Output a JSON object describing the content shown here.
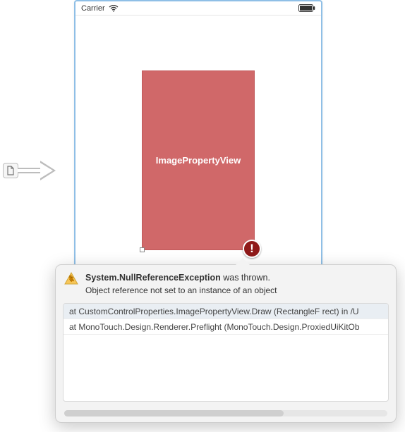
{
  "statusBar": {
    "carrier": "Carrier"
  },
  "component": {
    "label": "ImagePropertyView"
  },
  "errorBadge": {
    "mark": "!"
  },
  "popover": {
    "exception": "System.NullReferenceException",
    "thrownSuffix": " was thrown.",
    "message": "Object reference not set to an instance of an object",
    "stack": [
      "at CustomControlProperties.ImagePropertyView.Draw (RectangleF rect) in /U",
      "at MonoTouch.Design.Renderer.Preflight (MonoTouch.Design.ProxiedUiKitOb"
    ]
  }
}
